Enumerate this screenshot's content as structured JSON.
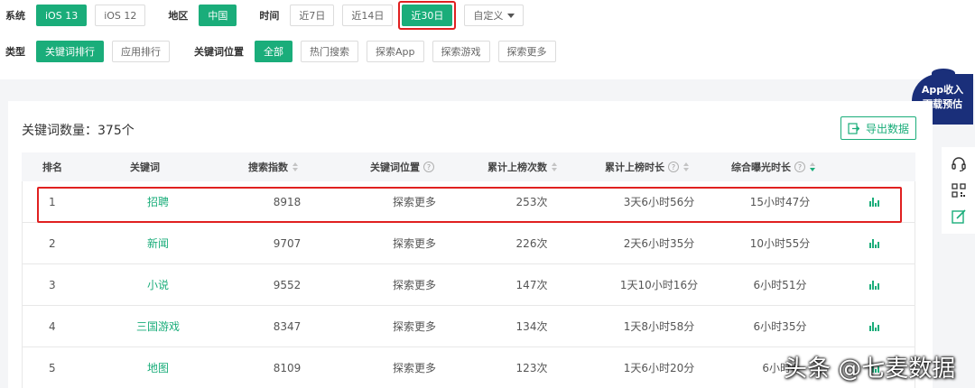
{
  "filters": {
    "system": {
      "label": "系统",
      "options": [
        "iOS 13",
        "iOS 12"
      ],
      "active": 0
    },
    "region": {
      "label": "地区",
      "options": [
        "中国"
      ],
      "active": 0
    },
    "time": {
      "label": "时间",
      "options": [
        "近7日",
        "近14日",
        "近30日"
      ],
      "active": 2,
      "custom": "自定义"
    },
    "type": {
      "label": "类型",
      "options": [
        "关键词排行",
        "应用排行"
      ],
      "active": 0
    },
    "position": {
      "label": "关键词位置",
      "options": [
        "全部",
        "热门搜索",
        "探索App",
        "探索游戏",
        "探索更多"
      ],
      "active": 0
    }
  },
  "card": {
    "count_label": "关键词数量：375个",
    "export_label": "导出数据"
  },
  "table": {
    "headers": [
      "排名",
      "关键词",
      "搜索指数",
      "关键词位置",
      "累计上榜次数",
      "累计上榜时长",
      "综合曝光时长"
    ],
    "rows": [
      {
        "rank": "1",
        "keyword": "招聘",
        "index": "8918",
        "position": "探索更多",
        "times": "253次",
        "duration": "3天6小时56分",
        "exposure": "15小时47分"
      },
      {
        "rank": "2",
        "keyword": "新闻",
        "index": "9707",
        "position": "探索更多",
        "times": "226次",
        "duration": "2天6小时35分",
        "exposure": "10小时55分"
      },
      {
        "rank": "3",
        "keyword": "小说",
        "index": "9552",
        "position": "探索更多",
        "times": "147次",
        "duration": "1天10小时16分",
        "exposure": "6小时51分"
      },
      {
        "rank": "4",
        "keyword": "三国游戏",
        "index": "8347",
        "position": "探索更多",
        "times": "134次",
        "duration": "1天8小时58分",
        "exposure": "6小时35分"
      },
      {
        "rank": "5",
        "keyword": "地图",
        "index": "8109",
        "position": "探索更多",
        "times": "123次",
        "duration": "1天6小时20分",
        "exposure": "6小时4"
      }
    ]
  },
  "promo": {
    "line1": "App收入",
    "line2": "下载预估"
  },
  "watermark": "头条 @七麦数据",
  "colors": {
    "accent": "#1aad7a",
    "highlight": "#e02020",
    "promo_bg": "#1a2f7a"
  },
  "icons": {
    "sidebar": [
      "headset-icon",
      "qrcode-icon",
      "edit-icon"
    ],
    "row_action": "bar-chart-icon",
    "export": "export-icon"
  }
}
